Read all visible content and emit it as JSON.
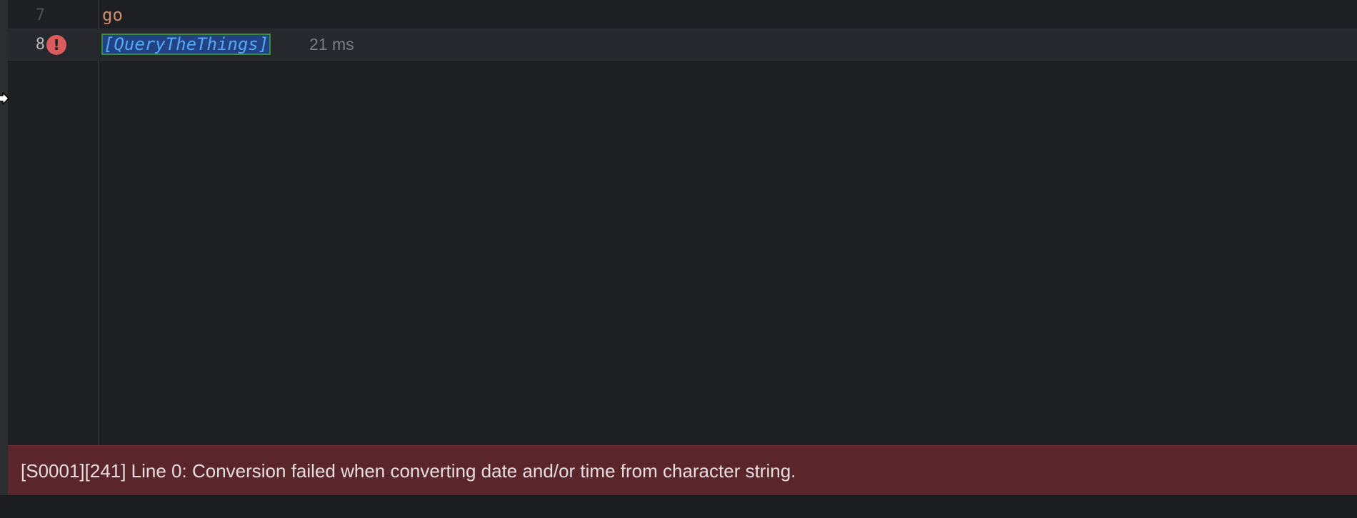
{
  "editor": {
    "lines": [
      {
        "number": "7",
        "text": "go"
      },
      {
        "number": "8",
        "text": "[QueryTheThings]",
        "hint": "21 ms",
        "has_error": true
      }
    ],
    "error_icon_glyph": "!"
  },
  "error_panel": {
    "message": "[S0001][241] Line 0: Conversion failed when converting date and/or time from character string."
  },
  "colors": {
    "background": "#1e1f22",
    "keyword": "#cf8e6d",
    "identifier": "#56a8f5",
    "error_bar": "#5a262b",
    "error_icon": "#db5c5c"
  },
  "icons": {
    "cursor": "move-cursor-icon",
    "gutter_error": "error-icon"
  }
}
